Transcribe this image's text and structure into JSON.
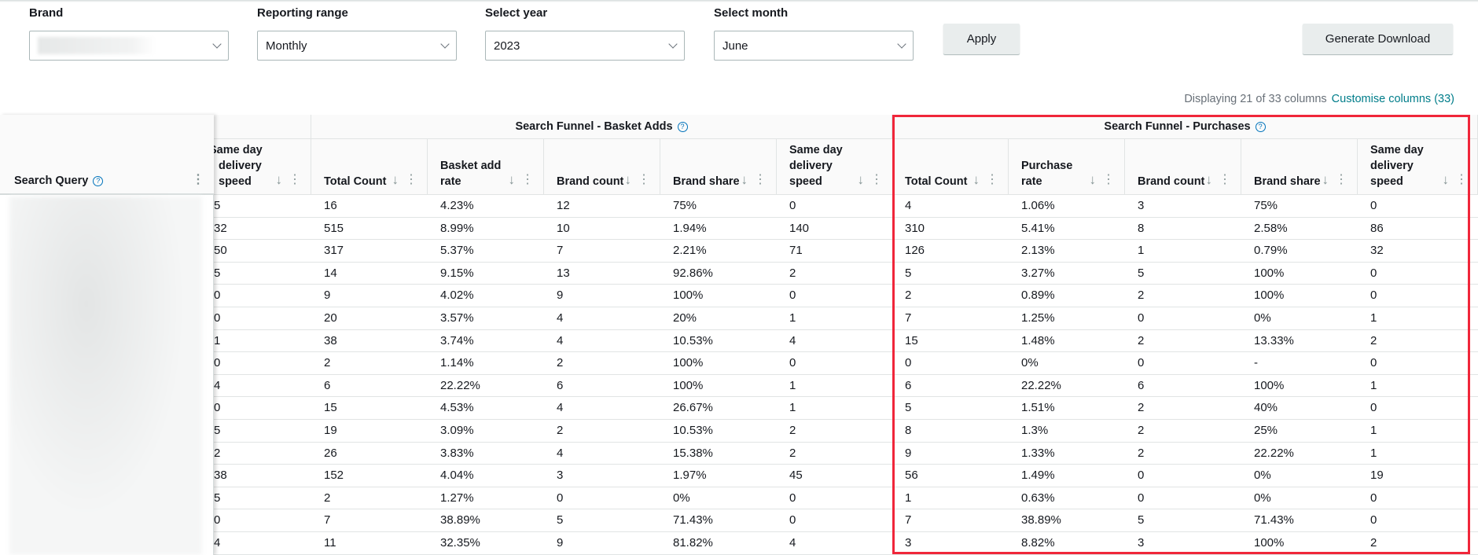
{
  "filters": {
    "brand": {
      "label": "Brand",
      "value": ""
    },
    "reporting_range": {
      "label": "Reporting range",
      "value": "Monthly"
    },
    "year": {
      "label": "Select year",
      "value": "2023"
    },
    "month": {
      "label": "Select month",
      "value": "June"
    }
  },
  "buttons": {
    "apply": "Apply",
    "generate_download": "Generate Download"
  },
  "columns_info": {
    "displaying": "Displaying 21 of 33 columns",
    "customise": "Customise columns (33)"
  },
  "table": {
    "frozen_header": "Search Query",
    "groups": [
      {
        "label": "Search Funnel - Basket Adds"
      },
      {
        "label": "Search Funnel - Purchases"
      }
    ],
    "partial_column": {
      "label": "Same day delivery speed",
      "values": [
        "5",
        "32",
        "50",
        "5",
        "0",
        "0",
        "1",
        "0",
        "4",
        "0",
        "5",
        "2",
        "38",
        "5",
        "0",
        "4"
      ]
    },
    "basket_columns": [
      "Total Count",
      "Basket add rate",
      "Brand count",
      "Brand share",
      "Same day delivery speed"
    ],
    "purchase_columns": [
      "Total Count",
      "Purchase rate",
      "Brand count",
      "Brand share",
      "Same day delivery speed"
    ],
    "rows": [
      {
        "basket": [
          "16",
          "4.23%",
          "12",
          "75%",
          "0"
        ],
        "purchase": [
          "4",
          "1.06%",
          "3",
          "75%",
          "0"
        ]
      },
      {
        "basket": [
          "515",
          "8.99%",
          "10",
          "1.94%",
          "140"
        ],
        "purchase": [
          "310",
          "5.41%",
          "8",
          "2.58%",
          "86"
        ]
      },
      {
        "basket": [
          "317",
          "5.37%",
          "7",
          "2.21%",
          "71"
        ],
        "purchase": [
          "126",
          "2.13%",
          "1",
          "0.79%",
          "32"
        ]
      },
      {
        "basket": [
          "14",
          "9.15%",
          "13",
          "92.86%",
          "2"
        ],
        "purchase": [
          "5",
          "3.27%",
          "5",
          "100%",
          "0"
        ]
      },
      {
        "basket": [
          "9",
          "4.02%",
          "9",
          "100%",
          "0"
        ],
        "purchase": [
          "2",
          "0.89%",
          "2",
          "100%",
          "0"
        ]
      },
      {
        "basket": [
          "20",
          "3.57%",
          "4",
          "20%",
          "1"
        ],
        "purchase": [
          "7",
          "1.25%",
          "0",
          "0%",
          "1"
        ]
      },
      {
        "basket": [
          "38",
          "3.74%",
          "4",
          "10.53%",
          "4"
        ],
        "purchase": [
          "15",
          "1.48%",
          "2",
          "13.33%",
          "2"
        ]
      },
      {
        "basket": [
          "2",
          "1.14%",
          "2",
          "100%",
          "0"
        ],
        "purchase": [
          "0",
          "0%",
          "0",
          "-",
          "0"
        ]
      },
      {
        "basket": [
          "6",
          "22.22%",
          "6",
          "100%",
          "1"
        ],
        "purchase": [
          "6",
          "22.22%",
          "6",
          "100%",
          "1"
        ]
      },
      {
        "basket": [
          "15",
          "4.53%",
          "4",
          "26.67%",
          "1"
        ],
        "purchase": [
          "5",
          "1.51%",
          "2",
          "40%",
          "0"
        ]
      },
      {
        "basket": [
          "19",
          "3.09%",
          "2",
          "10.53%",
          "2"
        ],
        "purchase": [
          "8",
          "1.3%",
          "2",
          "25%",
          "1"
        ]
      },
      {
        "basket": [
          "26",
          "3.83%",
          "4",
          "15.38%",
          "2"
        ],
        "purchase": [
          "9",
          "1.33%",
          "2",
          "22.22%",
          "1"
        ]
      },
      {
        "basket": [
          "152",
          "4.04%",
          "3",
          "1.97%",
          "45"
        ],
        "purchase": [
          "56",
          "1.49%",
          "0",
          "0%",
          "19"
        ]
      },
      {
        "basket": [
          "2",
          "1.27%",
          "0",
          "0%",
          "0"
        ],
        "purchase": [
          "1",
          "0.63%",
          "0",
          "0%",
          "0"
        ]
      },
      {
        "basket": [
          "7",
          "38.89%",
          "5",
          "71.43%",
          "0"
        ],
        "purchase": [
          "7",
          "38.89%",
          "5",
          "71.43%",
          "0"
        ]
      },
      {
        "basket": [
          "11",
          "32.35%",
          "9",
          "81.82%",
          "4"
        ],
        "purchase": [
          "3",
          "8.82%",
          "3",
          "100%",
          "2"
        ]
      }
    ]
  },
  "colors": {
    "highlight": "#f0263a",
    "link": "#007d8a"
  }
}
